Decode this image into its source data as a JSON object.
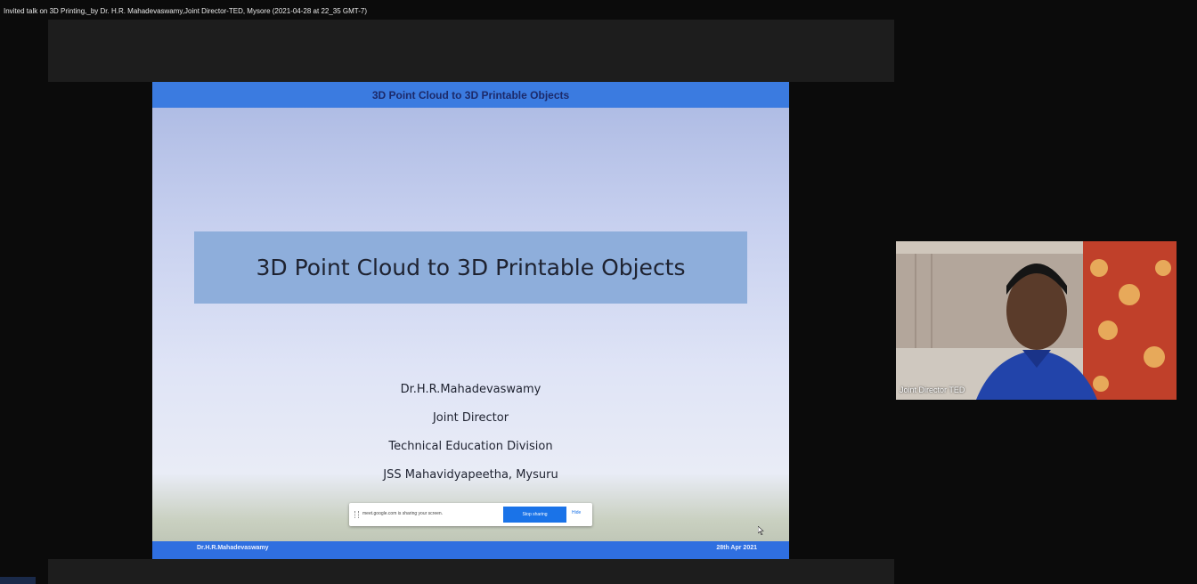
{
  "recording": {
    "title": "Invited talk on 3D Printing,_by Dr. H.R. Mahadevaswamy,Joint Director-TED, Mysore (2021-04-28 at 22_35 GMT-7)"
  },
  "slide": {
    "header": "3D Point Cloud to 3D Printable Objects",
    "title": "3D Point Cloud to 3D Printable Objects",
    "author_lines": [
      "Dr.H.R.Mahadevaswamy",
      "Joint Director",
      "Technical Education Division",
      "JSS Mahavidyapeetha, Mysuru"
    ],
    "footer_left": "Dr.H.R.Mahadevaswamy",
    "footer_right": "28th Apr 2021"
  },
  "share_bar": {
    "message": "meet.google.com is sharing your screen.",
    "stop_label": "Stop sharing",
    "hide_label": "Hide"
  },
  "participant": {
    "name": "Joint Director TED"
  },
  "colors": {
    "slide_header": "#3b7be0",
    "slide_footer": "#2f6fe0",
    "title_box": "#8eaedb",
    "stop_button": "#1a73e8"
  }
}
